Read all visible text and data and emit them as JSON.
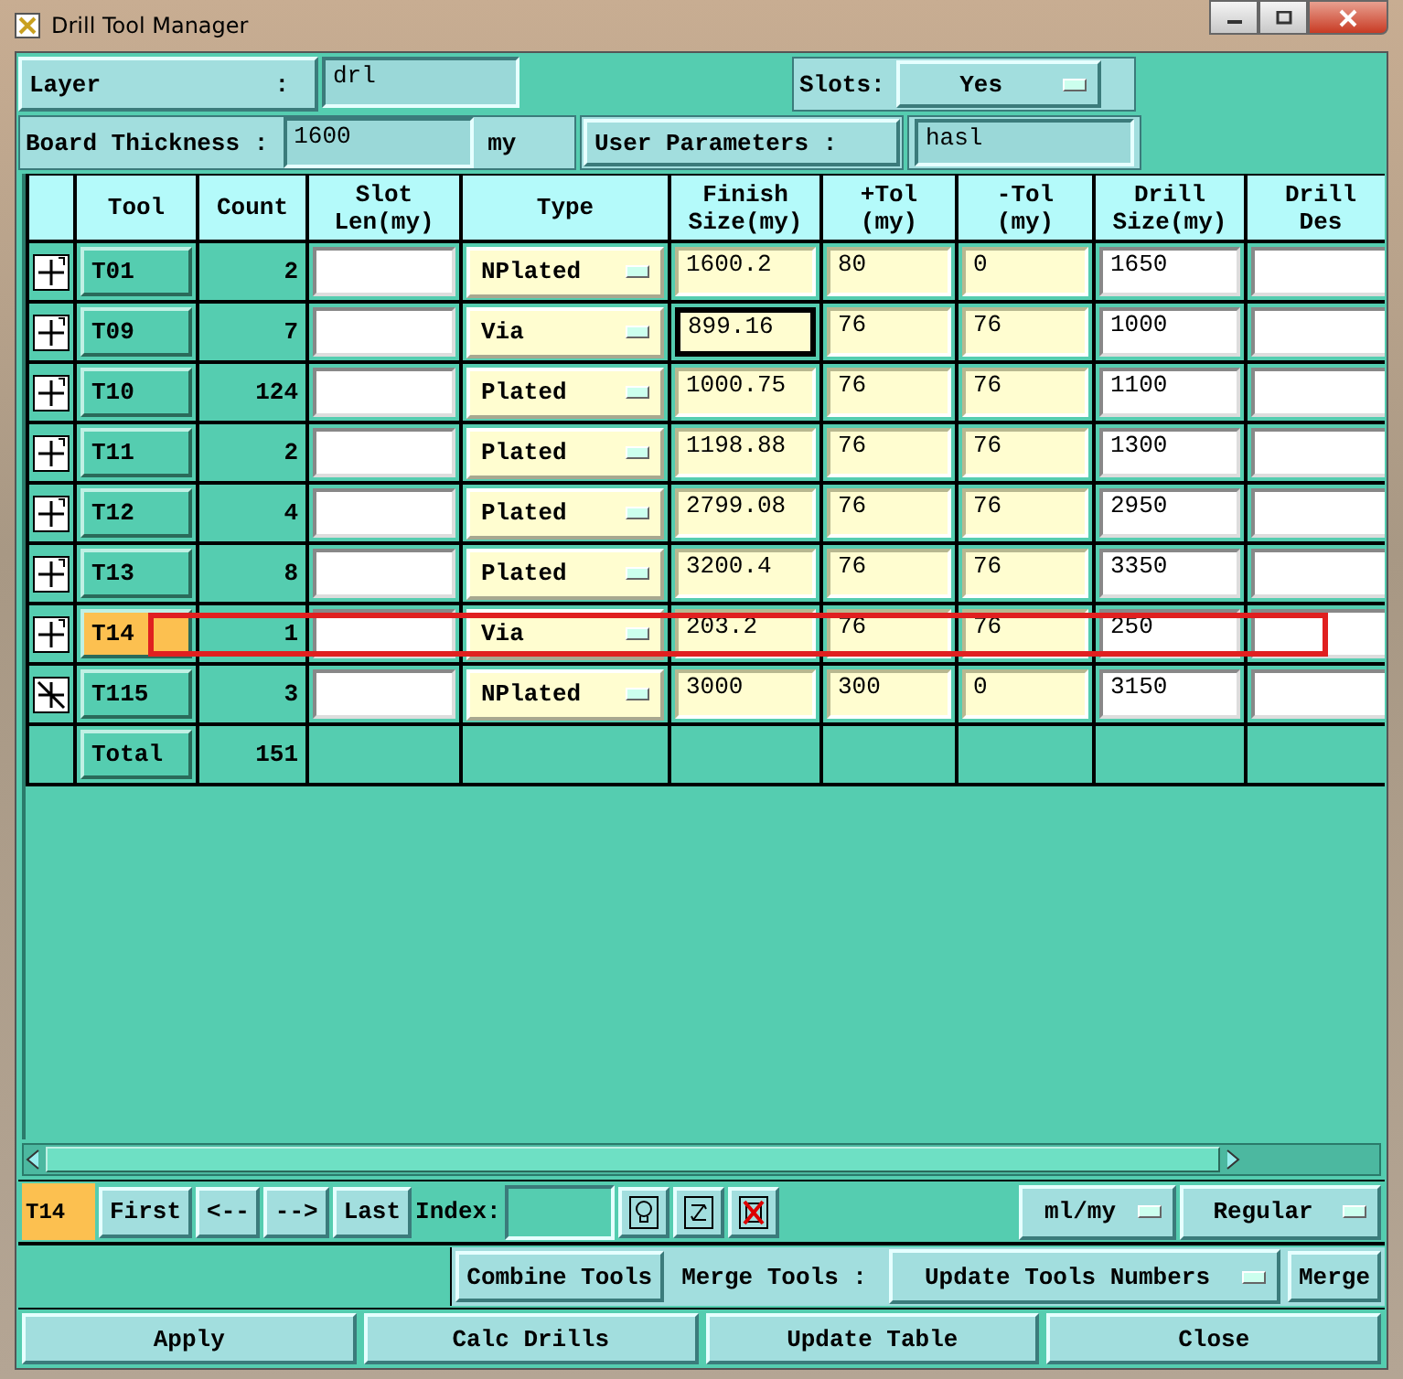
{
  "window": {
    "title": "Drill Tool Manager"
  },
  "layer": {
    "label": "Layer",
    "separator": ":",
    "value": "drl"
  },
  "slots": {
    "label": "Slots:",
    "value": "Yes"
  },
  "board_thickness": {
    "label": "Board Thickness :",
    "value": "1600",
    "unit": "my"
  },
  "user_parameters": {
    "label": "User Parameters :",
    "value": "hasl"
  },
  "table": {
    "columns": [
      "Tool",
      "Count",
      "Slot\nLen(my)",
      "Type",
      "Finish\nSize(my)",
      "+Tol\n(my)",
      "-Tol\n(my)",
      "Drill\nSize(my)",
      "Drill\nDes"
    ],
    "rows": [
      {
        "kind": "drill",
        "tool": "T01",
        "count": "2",
        "type": "NPlated",
        "finish": "1600.2",
        "plus_tol": "80",
        "minus_tol": "0",
        "drill_size": "1650",
        "selected": false,
        "highlighted": false,
        "finish_focused": false
      },
      {
        "kind": "drill",
        "tool": "T09",
        "count": "7",
        "type": "Via",
        "finish": "899.16",
        "plus_tol": "76",
        "minus_tol": "76",
        "drill_size": "1000",
        "selected": false,
        "highlighted": false,
        "finish_focused": true
      },
      {
        "kind": "drill",
        "tool": "T10",
        "count": "124",
        "type": "Plated",
        "finish": "1000.75",
        "plus_tol": "76",
        "minus_tol": "76",
        "drill_size": "1100",
        "selected": false,
        "highlighted": false,
        "finish_focused": false
      },
      {
        "kind": "drill",
        "tool": "T11",
        "count": "2",
        "type": "Plated",
        "finish": "1198.88",
        "plus_tol": "76",
        "minus_tol": "76",
        "drill_size": "1300",
        "selected": false,
        "highlighted": false,
        "finish_focused": false
      },
      {
        "kind": "drill",
        "tool": "T12",
        "count": "4",
        "type": "Plated",
        "finish": "2799.08",
        "plus_tol": "76",
        "minus_tol": "76",
        "drill_size": "2950",
        "selected": false,
        "highlighted": false,
        "finish_focused": false
      },
      {
        "kind": "drill",
        "tool": "T13",
        "count": "8",
        "type": "Plated",
        "finish": "3200.4",
        "plus_tol": "76",
        "minus_tol": "76",
        "drill_size": "3350",
        "selected": false,
        "highlighted": false,
        "finish_focused": false
      },
      {
        "kind": "drill",
        "tool": "T14",
        "count": "1",
        "type": "Via",
        "finish": "203.2",
        "plus_tol": "76",
        "minus_tol": "76",
        "drill_size": "250",
        "selected": true,
        "highlighted": true,
        "finish_focused": false
      },
      {
        "kind": "slot",
        "tool": "T115",
        "count": "3",
        "type": "NPlated",
        "finish": "3000",
        "plus_tol": "300",
        "minus_tol": "0",
        "drill_size": "3150",
        "selected": false,
        "highlighted": false,
        "finish_focused": false
      }
    ],
    "total": {
      "label": "Total",
      "count": "151"
    }
  },
  "nav": {
    "current": "T14",
    "buttons": [
      "First",
      "<--",
      "-->",
      "Last"
    ],
    "index_label": "Index:",
    "units": "ml/my",
    "mode": "Regular"
  },
  "merge_bar": {
    "combine": "Combine Tools",
    "merge_label": "Merge Tools :",
    "merge_option": "Update Tools Numbers",
    "merge": "Merge"
  },
  "buttons": [
    "Apply",
    "Calc Drills",
    "Update Table",
    "Close"
  ]
}
